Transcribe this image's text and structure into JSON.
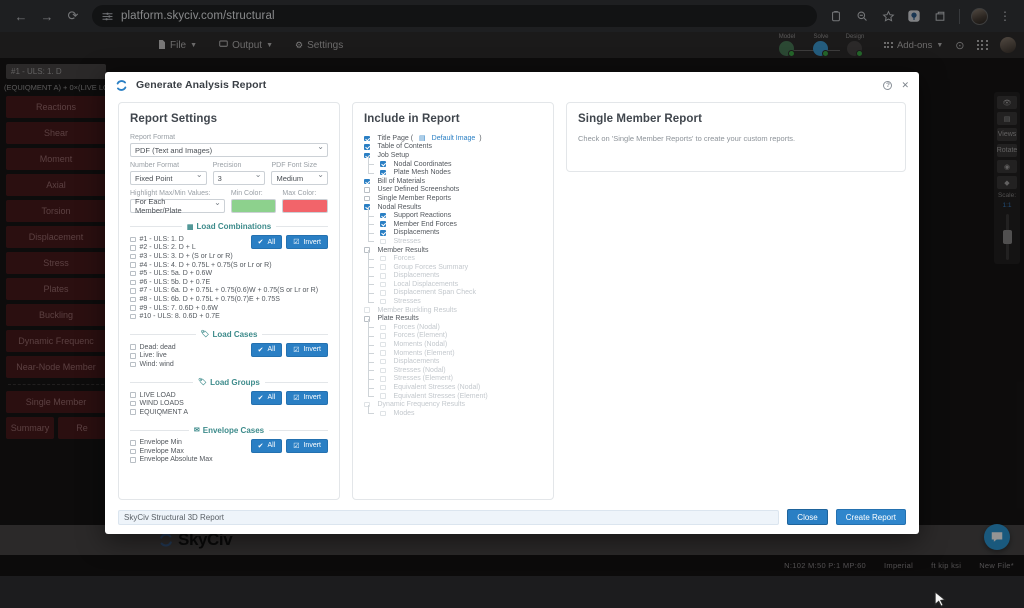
{
  "browser": {
    "url": "platform.skyciv.com/structural",
    "back_icon": "back-arrow-icon",
    "forward_icon": "forward-arrow-icon",
    "reload_icon": "reload-icon",
    "site_settings_icon": "site-settings-icon",
    "clipboard_icon": "clipboard-icon",
    "zoom_icon": "zoom-out-icon",
    "bookmark_icon": "star-icon",
    "extension_icon": "extension-icon",
    "split_icon": "split-view-icon",
    "menu_icon": "three-dot-menu-icon"
  },
  "app": {
    "menu": [
      {
        "label": "File",
        "icon": "file-icon"
      },
      {
        "label": "Output",
        "icon": "monitor-icon"
      },
      {
        "label": "Settings",
        "icon": "gear-icon"
      }
    ],
    "status_steps": [
      {
        "label": "Model"
      },
      {
        "label": "Solve"
      },
      {
        "label": "Design"
      }
    ],
    "addons_label": "Add-ons",
    "help_icon": "question-circle-icon",
    "apps_icon": "app-grid-icon",
    "avatar": "user-avatar",
    "combo_chip": "#1 - ULS: 1. D",
    "combo_desc": "(EQUIQMENT A) + 0×(LIVE LO",
    "result_buttons": [
      "Reactions",
      "Shear",
      "Moment",
      "Axial",
      "Torsion",
      "Displacement",
      "Stress",
      "Plates",
      "Buckling",
      "Dynamic Frequenc",
      "Near-Node Member"
    ],
    "single_member_button": "Single Member",
    "bottom_buttons": [
      "Summary",
      "Re"
    ],
    "right_tools": {
      "buttons": [
        "eye-icon",
        "image-icon",
        "Views",
        "Rotate",
        "camera-icon",
        "cube-icon"
      ],
      "scale_label": "Scale:",
      "scale_value": "1:1"
    },
    "footer_logo": "SkyCiv",
    "statusbar": {
      "counts": "N:102  M:50  P:1  MP:60",
      "units_system": "Imperial",
      "units": "ft  kip  ksi",
      "file": "New File*"
    }
  },
  "modal": {
    "title": "Generate Analysis Report",
    "logo_icon": "skyciv-logo-icon",
    "help_icon": "help-icon",
    "close_icon": "close-icon",
    "settings": {
      "heading": "Report Settings",
      "report_format": {
        "label": "Report Format",
        "value": "PDF (Text and Images)"
      },
      "number_format": {
        "label": "Number Format",
        "value": "Fixed Point"
      },
      "precision": {
        "label": "Precision",
        "value": "3"
      },
      "pdf_font_size": {
        "label": "PDF Font Size",
        "value": "Medium"
      },
      "highlight": {
        "label": "Highlight Max/Min Values:",
        "value": "For Each Member/Plate"
      },
      "min_color": {
        "label": "Min Color:",
        "hex": "#8dd18d"
      },
      "max_color": {
        "label": "Max Color:",
        "hex": "#f2646a"
      },
      "all_label": "All",
      "invert_label": "Invert",
      "load_combinations": {
        "title": "Load Combinations",
        "icon": "table-icon",
        "items": [
          {
            "label": "#1 - ULS: 1. D",
            "checked": false
          },
          {
            "label": "#2 - ULS: 2. D + L",
            "checked": false
          },
          {
            "label": "#3 - ULS: 3. D + (S or Lr or R)",
            "checked": false
          },
          {
            "label": "#4 - ULS: 4. D + 0.75L + 0.75(S or Lr or R)",
            "checked": false
          },
          {
            "label": "#5 - ULS: 5a. D + 0.6W",
            "checked": false
          },
          {
            "label": "#6 - ULS: 5b. D + 0.7E",
            "checked": false
          },
          {
            "label": "#7 - ULS: 6a. D + 0.75L + 0.75(0.6)W + 0.75(S or Lr or R)",
            "checked": false
          },
          {
            "label": "#8 - ULS: 6b. D + 0.75L + 0.75(0.7)E + 0.75S",
            "checked": false
          },
          {
            "label": "#9 - ULS: 7. 0.6D + 0.6W",
            "checked": false
          },
          {
            "label": "#10 - ULS: 8. 0.6D + 0.7E",
            "checked": false
          }
        ]
      },
      "load_cases": {
        "title": "Load Cases",
        "icon": "tag-icon",
        "items": [
          {
            "label": "Dead: dead",
            "checked": false
          },
          {
            "label": "Live: live",
            "checked": false
          },
          {
            "label": "Wind: wind",
            "checked": false
          }
        ]
      },
      "load_groups": {
        "title": "Load Groups",
        "icon": "tag-icon",
        "items": [
          {
            "label": "LIVE LOAD",
            "checked": false
          },
          {
            "label": "WIND LOADS",
            "checked": false
          },
          {
            "label": "EQUIQMENT A",
            "checked": false
          }
        ]
      },
      "envelope_cases": {
        "title": "Envelope Cases",
        "icon": "envelope-icon",
        "items": [
          {
            "label": "Envelope Min",
            "checked": false
          },
          {
            "label": "Envelope Max",
            "checked": false
          },
          {
            "label": "Envelope Absolute Max",
            "checked": false
          }
        ]
      }
    },
    "include": {
      "heading": "Include in Report",
      "items": [
        {
          "label": "Title Page (",
          "link": "Default Image",
          "link_suffix": ")",
          "link_icon": "image-icon",
          "checked": true,
          "indent": 0,
          "disabled": false
        },
        {
          "label": "Table of Contents",
          "checked": true,
          "indent": 0,
          "disabled": false
        },
        {
          "label": "Job Setup",
          "checked": true,
          "indent": 0,
          "disabled": false
        },
        {
          "label": "Nodal Coordinates",
          "checked": true,
          "indent": 1,
          "disabled": false
        },
        {
          "label": "Plate Mesh Nodes",
          "checked": true,
          "indent": 1,
          "disabled": false
        },
        {
          "label": "Bill of Materials",
          "checked": true,
          "indent": 0,
          "disabled": false
        },
        {
          "label": "User Defined Screenshots",
          "checked": false,
          "indent": 0,
          "disabled": false
        },
        {
          "label": "Single Member Reports",
          "checked": false,
          "indent": 0,
          "disabled": false
        },
        {
          "label": "Nodal Results",
          "checked": true,
          "indent": 0,
          "disabled": false
        },
        {
          "label": "Support Reactions",
          "checked": true,
          "indent": 1,
          "disabled": false
        },
        {
          "label": "Member End Forces",
          "checked": true,
          "indent": 1,
          "disabled": false
        },
        {
          "label": "Displacements",
          "checked": true,
          "indent": 1,
          "disabled": false
        },
        {
          "label": "Stresses",
          "checked": false,
          "indent": 1,
          "disabled": true
        },
        {
          "label": "Member Results",
          "checked": false,
          "indent": 0,
          "disabled": false
        },
        {
          "label": "Forces",
          "checked": false,
          "indent": 1,
          "disabled": true
        },
        {
          "label": "Group Forces Summary",
          "checked": false,
          "indent": 1,
          "disabled": true
        },
        {
          "label": "Displacements",
          "checked": false,
          "indent": 1,
          "disabled": true
        },
        {
          "label": "Local Displacements",
          "checked": false,
          "indent": 1,
          "disabled": true
        },
        {
          "label": "Displacement Span Check",
          "checked": false,
          "indent": 1,
          "disabled": true
        },
        {
          "label": "Stresses",
          "checked": false,
          "indent": 1,
          "disabled": true
        },
        {
          "label": "Member Buckling Results",
          "checked": false,
          "indent": 0,
          "disabled": true
        },
        {
          "label": "Plate Results",
          "checked": false,
          "indent": 0,
          "disabled": false
        },
        {
          "label": "Forces (Nodal)",
          "checked": false,
          "indent": 1,
          "disabled": true
        },
        {
          "label": "Forces (Element)",
          "checked": false,
          "indent": 1,
          "disabled": true
        },
        {
          "label": "Moments (Nodal)",
          "checked": false,
          "indent": 1,
          "disabled": true
        },
        {
          "label": "Moments (Element)",
          "checked": false,
          "indent": 1,
          "disabled": true
        },
        {
          "label": "Displacements",
          "checked": false,
          "indent": 1,
          "disabled": true
        },
        {
          "label": "Stresses (Nodal)",
          "checked": false,
          "indent": 1,
          "disabled": true
        },
        {
          "label": "Stresses (Element)",
          "checked": false,
          "indent": 1,
          "disabled": true
        },
        {
          "label": "Equivalent Stresses (Nodal)",
          "checked": false,
          "indent": 1,
          "disabled": true
        },
        {
          "label": "Equivalent Stresses (Element)",
          "checked": false,
          "indent": 1,
          "disabled": true
        },
        {
          "label": "Dynamic Frequency Results",
          "checked": false,
          "indent": 0,
          "disabled": true
        },
        {
          "label": "Modes",
          "checked": false,
          "indent": 1,
          "disabled": true
        }
      ]
    },
    "single_member": {
      "heading": "Single Member Report",
      "description": "Check on 'Single Member Reports' to create your custom reports."
    },
    "footer": {
      "report_name": "SkyCiv Structural 3D Report",
      "close_label": "Close",
      "create_label": "Create Report"
    }
  },
  "colors": {
    "accent_blue": "#2a7fc4",
    "teal": "#3d8b8b",
    "maroon": "#4b1b1d"
  }
}
